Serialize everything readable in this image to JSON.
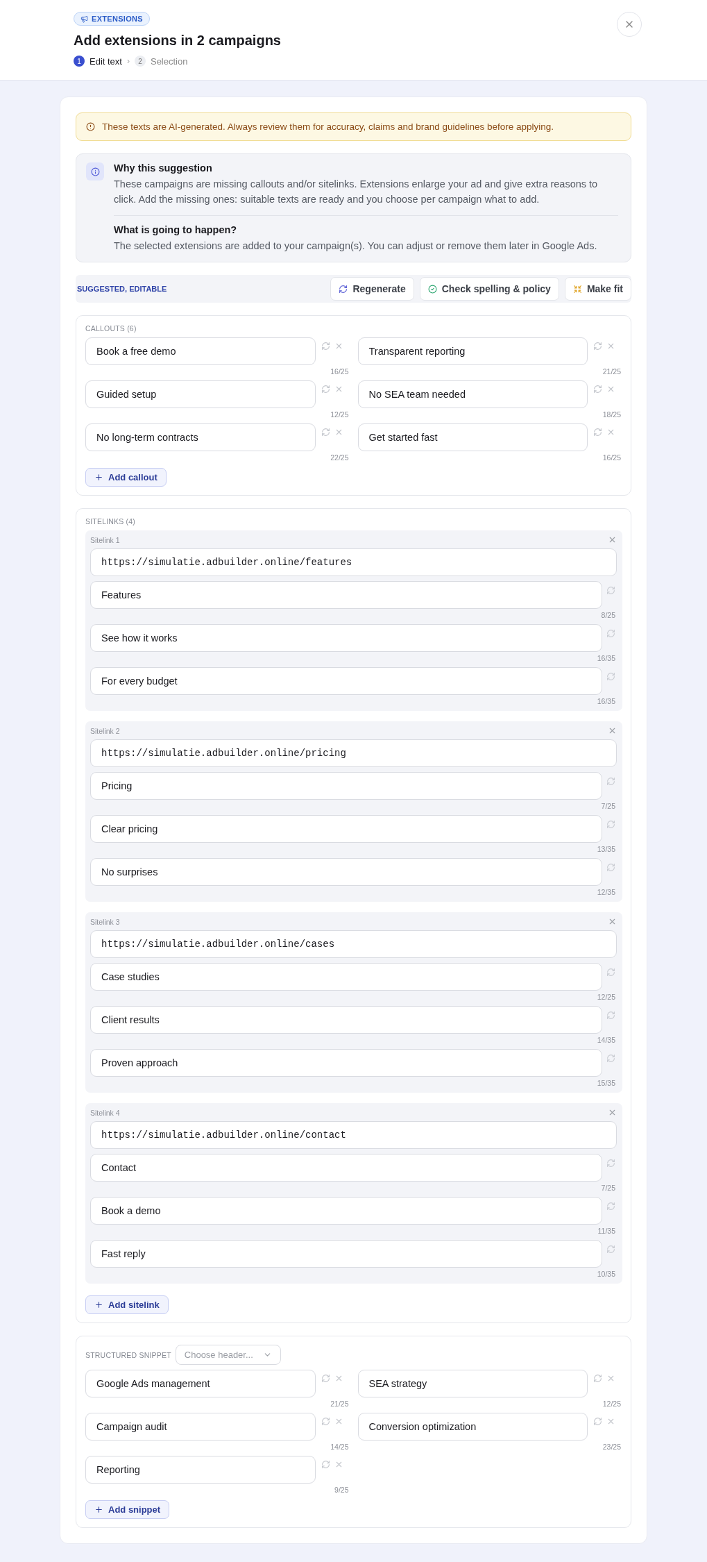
{
  "header": {
    "badge": "EXTENSIONS",
    "title": "Add extensions in 2 campaigns",
    "steps": [
      {
        "number": "1",
        "label": "Edit text",
        "selected": true
      },
      {
        "number": "2",
        "label": "Selection",
        "selected": false
      }
    ],
    "step_separator": "›"
  },
  "alert": "These texts are AI-generated. Always review them for accuracy, claims and brand guidelines before applying.",
  "info": [
    {
      "title": "Why this suggestion",
      "text": "These campaigns are missing callouts and/or sitelinks. Extensions enlarge your ad and give extra reasons to click. Add the missing ones: suitable texts are ready and you choose per campaign what to add."
    },
    {
      "title": "What is going to happen?",
      "text": "The selected extensions are added to your campaign(s). You can adjust or remove them later in Google Ads."
    }
  ],
  "toolbar": {
    "label": "SUGGESTED, EDITABLE",
    "buttons": [
      {
        "kind": "regenerate",
        "label": "Regenerate"
      },
      {
        "kind": "check",
        "label": "Check spelling & policy"
      },
      {
        "kind": "fit",
        "label": "Make fit"
      }
    ]
  },
  "callouts": {
    "heading": "CALLOUTS (6)",
    "items": [
      {
        "value": "Book a free demo",
        "count": "16/25"
      },
      {
        "value": "Transparent reporting",
        "count": "21/25"
      },
      {
        "value": "Guided setup",
        "count": "12/25"
      },
      {
        "value": "No SEA team needed",
        "count": "18/25"
      },
      {
        "value": "No long-term contracts",
        "count": "22/25"
      },
      {
        "value": "Get started fast",
        "count": "16/25"
      }
    ],
    "add": "Add callout"
  },
  "sitelinks": {
    "heading": "SITELINKS (4)",
    "items": [
      {
        "label": "Sitelink 1",
        "url": "https://simulatie.adbuilder.online/features",
        "fields": [
          {
            "value": "Features",
            "count": "8/25"
          },
          {
            "value": "See how it works",
            "count": "16/35"
          },
          {
            "value": "For every budget",
            "count": "16/35"
          }
        ]
      },
      {
        "label": "Sitelink 2",
        "url": "https://simulatie.adbuilder.online/pricing",
        "fields": [
          {
            "value": "Pricing",
            "count": "7/25"
          },
          {
            "value": "Clear pricing",
            "count": "13/35"
          },
          {
            "value": "No surprises",
            "count": "12/35"
          }
        ]
      },
      {
        "label": "Sitelink 3",
        "url": "https://simulatie.adbuilder.online/cases",
        "fields": [
          {
            "value": "Case studies",
            "count": "12/25"
          },
          {
            "value": "Client results",
            "count": "14/35"
          },
          {
            "value": "Proven approach",
            "count": "15/35"
          }
        ]
      },
      {
        "label": "Sitelink 4",
        "url": "https://simulatie.adbuilder.online/contact",
        "fields": [
          {
            "value": "Contact",
            "count": "7/25"
          },
          {
            "value": "Book a demo",
            "count": "11/35"
          },
          {
            "value": "Fast reply",
            "count": "10/35"
          }
        ]
      }
    ],
    "add": "Add sitelink"
  },
  "snippet": {
    "heading": "STRUCTURED SNIPPET",
    "header_select": {
      "placeholder": "Choose header..."
    },
    "items": [
      {
        "value": "Google Ads management",
        "count": "21/25"
      },
      {
        "value": "SEA strategy",
        "count": "12/25"
      },
      {
        "value": "Campaign audit",
        "count": "14/25"
      },
      {
        "value": "Conversion optimization",
        "count": "23/25"
      },
      {
        "value": "Reporting",
        "count": "9/25"
      }
    ],
    "add": "Add snippet"
  }
}
